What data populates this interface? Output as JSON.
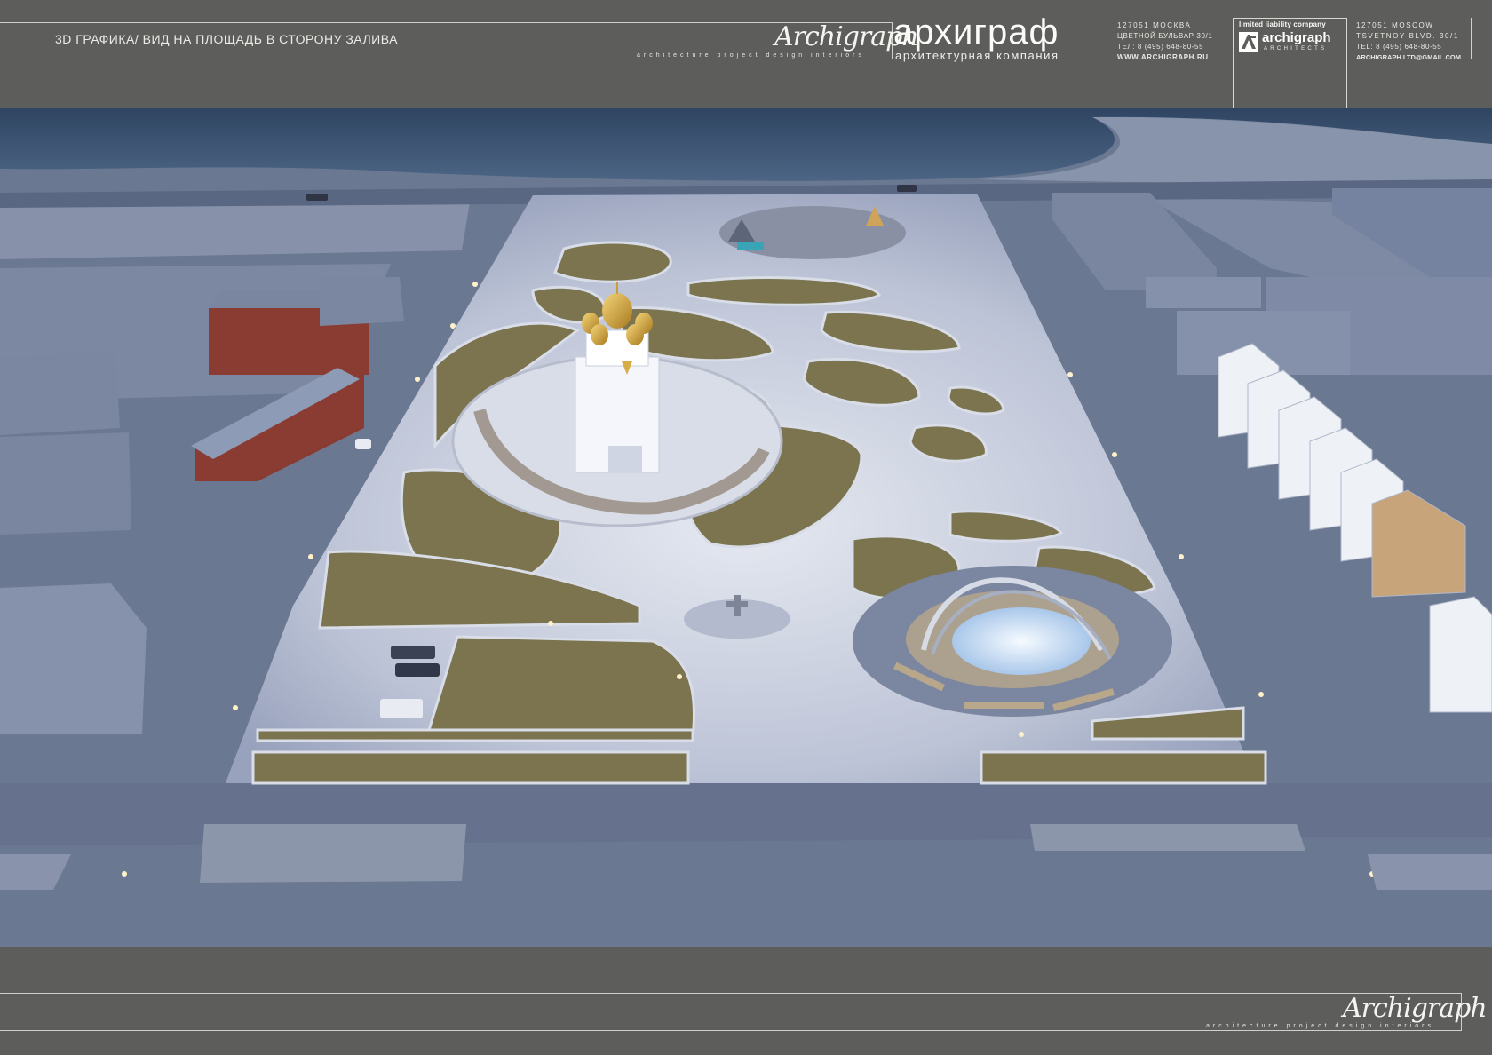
{
  "header": {
    "title": "3D ГРАФИКА/ ВИД НА ПЛОЩАДЬ В СТОРОНУ ЗАЛИВА",
    "signature": "Archigraph",
    "tagline": "architecture   project   design   interiors",
    "ru_wordmark": "архиграф",
    "ru_subtitle": "архитектурная компания",
    "ru_address": [
      "127051 МОСКВА",
      "ЦВЕТНОЙ БУЛЬВАР 30/1",
      "ТЕЛ: 8 (495) 648-80-55",
      "WWW.ARCHIGRAPH.RU"
    ],
    "logo": {
      "llc_label": "limited liability company",
      "brand_name": "archigraph",
      "brand_sub": "ARCHITECTS"
    },
    "en_address": [
      "127051 MOSCOW",
      "TSVETNOY BLVD. 30/1",
      "TEL: 8 (495) 648-80-55",
      "ARCHIGRAPH.LTD@GMAIL.COM"
    ]
  },
  "footer": {
    "signature": "Archigraph",
    "tagline": "architecture   project   design   interiors"
  },
  "colors": {
    "frame": "#5d5e5b",
    "water": "#3f5572",
    "plaza": "#c5cbdc",
    "ground": "#6a778f",
    "grass": "#7d7552",
    "gold": "#d7ac47"
  }
}
